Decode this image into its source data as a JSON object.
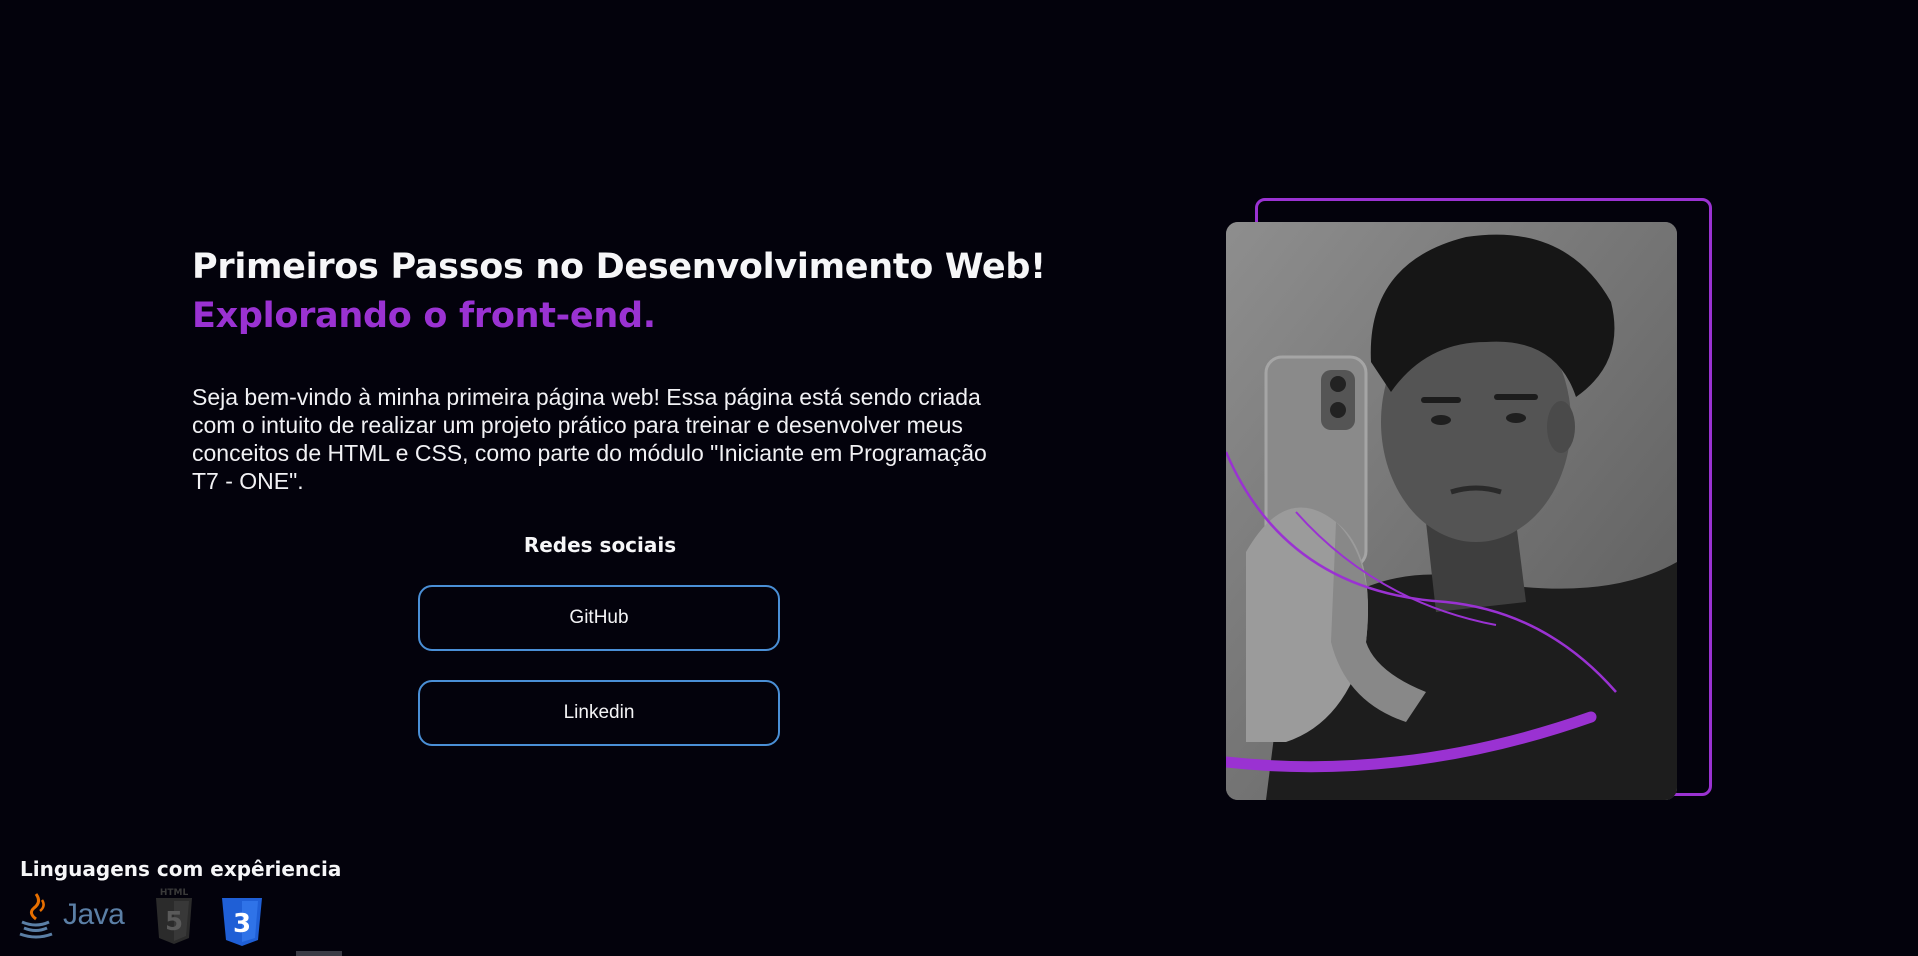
{
  "hero": {
    "title": "Primeiros Passos no Desenvolvimento Web!",
    "subtitle": "Explorando o front-end.",
    "intro": "Seja bem-vindo à minha primeira página web! Essa página está sendo criada com o intuito de realizar um projeto prático para treinar e desenvolver meus conceitos de HTML e CSS, como parte do módulo \"Iniciante em Programação T7 - ONE\"."
  },
  "social": {
    "title": "Redes sociais",
    "buttons": [
      "GitHub",
      "Linkedin"
    ]
  },
  "languages": {
    "title": "Linguagens com expêriencia",
    "items": [
      {
        "name": "java-icon",
        "label": "Java"
      },
      {
        "name": "html5-icon",
        "label": "HTML",
        "badge": "5"
      },
      {
        "name": "css3-icon",
        "label": "3"
      }
    ]
  },
  "colors": {
    "background": "#03020c",
    "accent_purple": "#9a32d2",
    "button_border": "#4a8fd6"
  }
}
